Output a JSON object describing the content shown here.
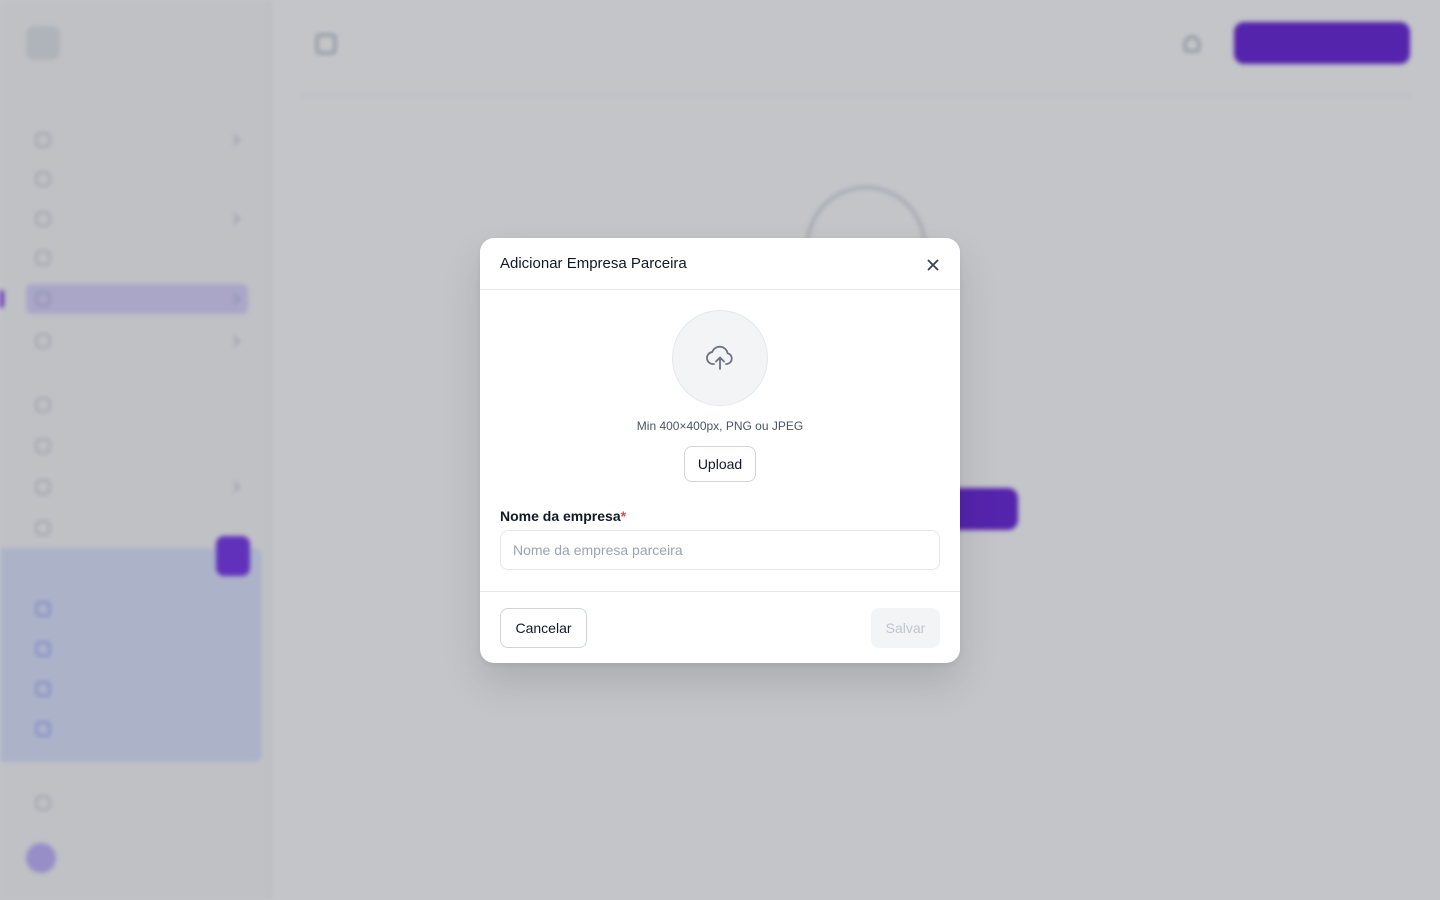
{
  "modal": {
    "title": "Adicionar Empresa Parceira",
    "close_icon": "close-icon",
    "upload": {
      "icon": "cloud-upload-icon",
      "hint": "Min 400×400px, PNG ou JPEG",
      "button_label": "Upload"
    },
    "company_name": {
      "label": "Nome da empresa",
      "required_marker": "*",
      "value": "",
      "placeholder": "Nome da empresa parceira"
    },
    "footer": {
      "cancel_label": "Cancelar",
      "save_label": "Salvar",
      "save_disabled": true
    }
  },
  "colors": {
    "accent": "#6d28d9",
    "required": "#ef4444",
    "overlay": "rgba(17,24,39,0.25)"
  }
}
